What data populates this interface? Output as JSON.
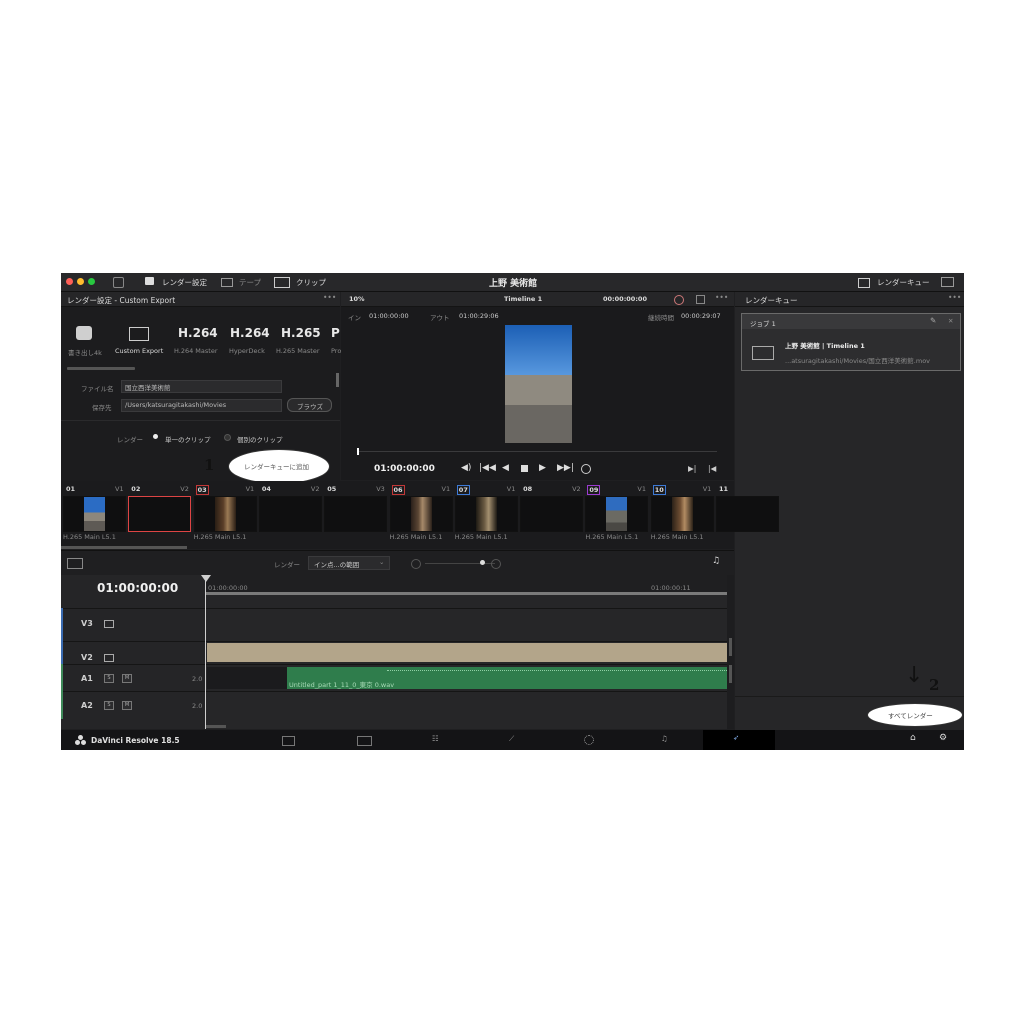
{
  "window": {
    "title": "上野 美術館",
    "menu_render_settings": "レンダー設定",
    "menu_tape": "テープ",
    "menu_clip": "クリップ",
    "menu_render_queue": "レンダーキュー"
  },
  "render_settings": {
    "header": "レンダー設定 - Custom Export",
    "presets": [
      {
        "label": "書き出し4k",
        "icon": "preset-people-icon"
      },
      {
        "label": "Custom Export",
        "icon": "film-strip-icon"
      },
      {
        "big": "H.264",
        "label": "H.264 Master"
      },
      {
        "big": "H.264",
        "label": "HyperDeck"
      },
      {
        "big": "H.265",
        "label": "H.265 Master"
      },
      {
        "big": "P",
        "label": "Pro"
      }
    ],
    "filename_label": "ファイル名",
    "filename_value": "国立西洋美術館",
    "location_label": "保存先",
    "location_value": "/Users/katsuragitakashi/Movies",
    "browse_label": "ブラウズ",
    "render_label": "レンダー",
    "single_clip": "単一のクリップ",
    "multi_clip": "個別のクリップ",
    "add_queue_button": "レンダーキューに追加"
  },
  "viewer": {
    "zoom": "10%",
    "timeline_name": "Timeline 1",
    "timecode_top": "00:00:00:00",
    "in_label": "イン",
    "in_tc": "01:00:00:00",
    "out_label": "アウト",
    "out_tc": "01:00:29:06",
    "duration_label": "継続時間",
    "duration_tc": "00:00:29:07",
    "current_tc": "01:00:00:00"
  },
  "render_queue": {
    "header": "レンダーキュー",
    "job_title": "ジョブ 1",
    "job_name": "上野 美術館 | Timeline 1",
    "job_path": "...atsuragitakashi/Movies/国立西洋美術館.mov",
    "render_all_button": "すべてレンダー"
  },
  "clips": [
    {
      "num": "01",
      "track": "V1",
      "codec": "H.265 Main L5.1"
    },
    {
      "num": "02",
      "track": "V2",
      "codec": ""
    },
    {
      "num": "03",
      "track": "V1",
      "codec": "H.265 Main L5.1"
    },
    {
      "num": "04",
      "track": "V2",
      "codec": ""
    },
    {
      "num": "05",
      "track": "V3",
      "codec": ""
    },
    {
      "num": "06",
      "track": "V1",
      "codec": "H.265 Main L5.1"
    },
    {
      "num": "07",
      "track": "V1",
      "codec": "H.265 Main L5.1"
    },
    {
      "num": "08",
      "track": "V2",
      "codec": ""
    },
    {
      "num": "09",
      "track": "V1",
      "codec": "H.265 Main L5.1"
    },
    {
      "num": "10",
      "track": "V1",
      "codec": "H.265 Main L5.1"
    },
    {
      "num": "11",
      "track": "",
      "codec": ""
    }
  ],
  "timeline": {
    "render_label": "レンダー",
    "range_value": "イン点...の範囲",
    "timecode": "01:00:00:00",
    "ruler_start": "01:00:00:00",
    "ruler_mid": "01:00:00:11",
    "tracks": [
      {
        "name": "V3"
      },
      {
        "name": "V2"
      },
      {
        "name": "A1",
        "level": "2.0"
      },
      {
        "name": "A2",
        "level": "2.0"
      }
    ],
    "s_label": "S",
    "m_label": "M",
    "audio_clip_name": "Untitled_part 1_11_0_東京 0.wav"
  },
  "footer": {
    "app_name": "DaVinci Resolve 18.5"
  },
  "annotations": {
    "one": "1",
    "two": "2"
  }
}
